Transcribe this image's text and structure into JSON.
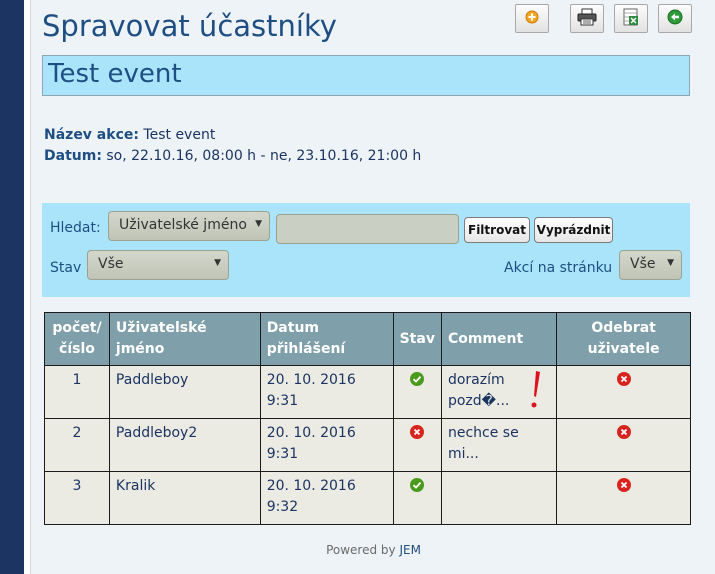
{
  "header": {
    "title": "Spravovat účastníky"
  },
  "toolbar": {
    "buttons": [
      {
        "name": "add-icon"
      },
      {
        "name": "print-icon"
      },
      {
        "name": "export-excel-icon"
      },
      {
        "name": "back-icon"
      }
    ]
  },
  "event": {
    "name_bar": "Test event",
    "name_label": "Název akce:",
    "name_value": "Test event",
    "date_label": "Datum:",
    "date_value": "so, 22.10.16, 08:00 h - ne, 23.10.16, 21:00 h"
  },
  "filter": {
    "search_label": "Hledat:",
    "search_field_select": "Uživatelské jméno",
    "search_value": "",
    "filter_button": "Filtrovat",
    "clear_button": "Vyprázdnit",
    "status_label": "Stav",
    "status_value": "Vše",
    "per_page_label": "Akcí na stránku",
    "per_page_value": "Vše"
  },
  "table": {
    "headers": [
      "počet/ číslo",
      "Uživatelské jméno",
      "Datum přihlášení",
      "Stav",
      "Comment",
      "Odebrat uživatele"
    ],
    "rows": [
      {
        "num": "1",
        "user": "Paddleboy",
        "date": "20. 10. 2016 9:31",
        "status": "ok",
        "comment": "dorazím pozd�..."
      },
      {
        "num": "2",
        "user": "Paddleboy2",
        "date": "20. 10. 2016 9:31",
        "status": "no",
        "comment": "nechce se mi..."
      },
      {
        "num": "3",
        "user": "Kralik",
        "date": "20. 10. 2016 9:32",
        "status": "ok",
        "comment": ""
      }
    ]
  },
  "footer": {
    "powered_by": "Powered by",
    "jem": "JEM"
  },
  "colors": {
    "accent": "#1f4f82",
    "banner": "#a9e4fb",
    "table_header": "#7fa0aa",
    "ok": "#4a9a1e",
    "remove": "#d9231f"
  }
}
